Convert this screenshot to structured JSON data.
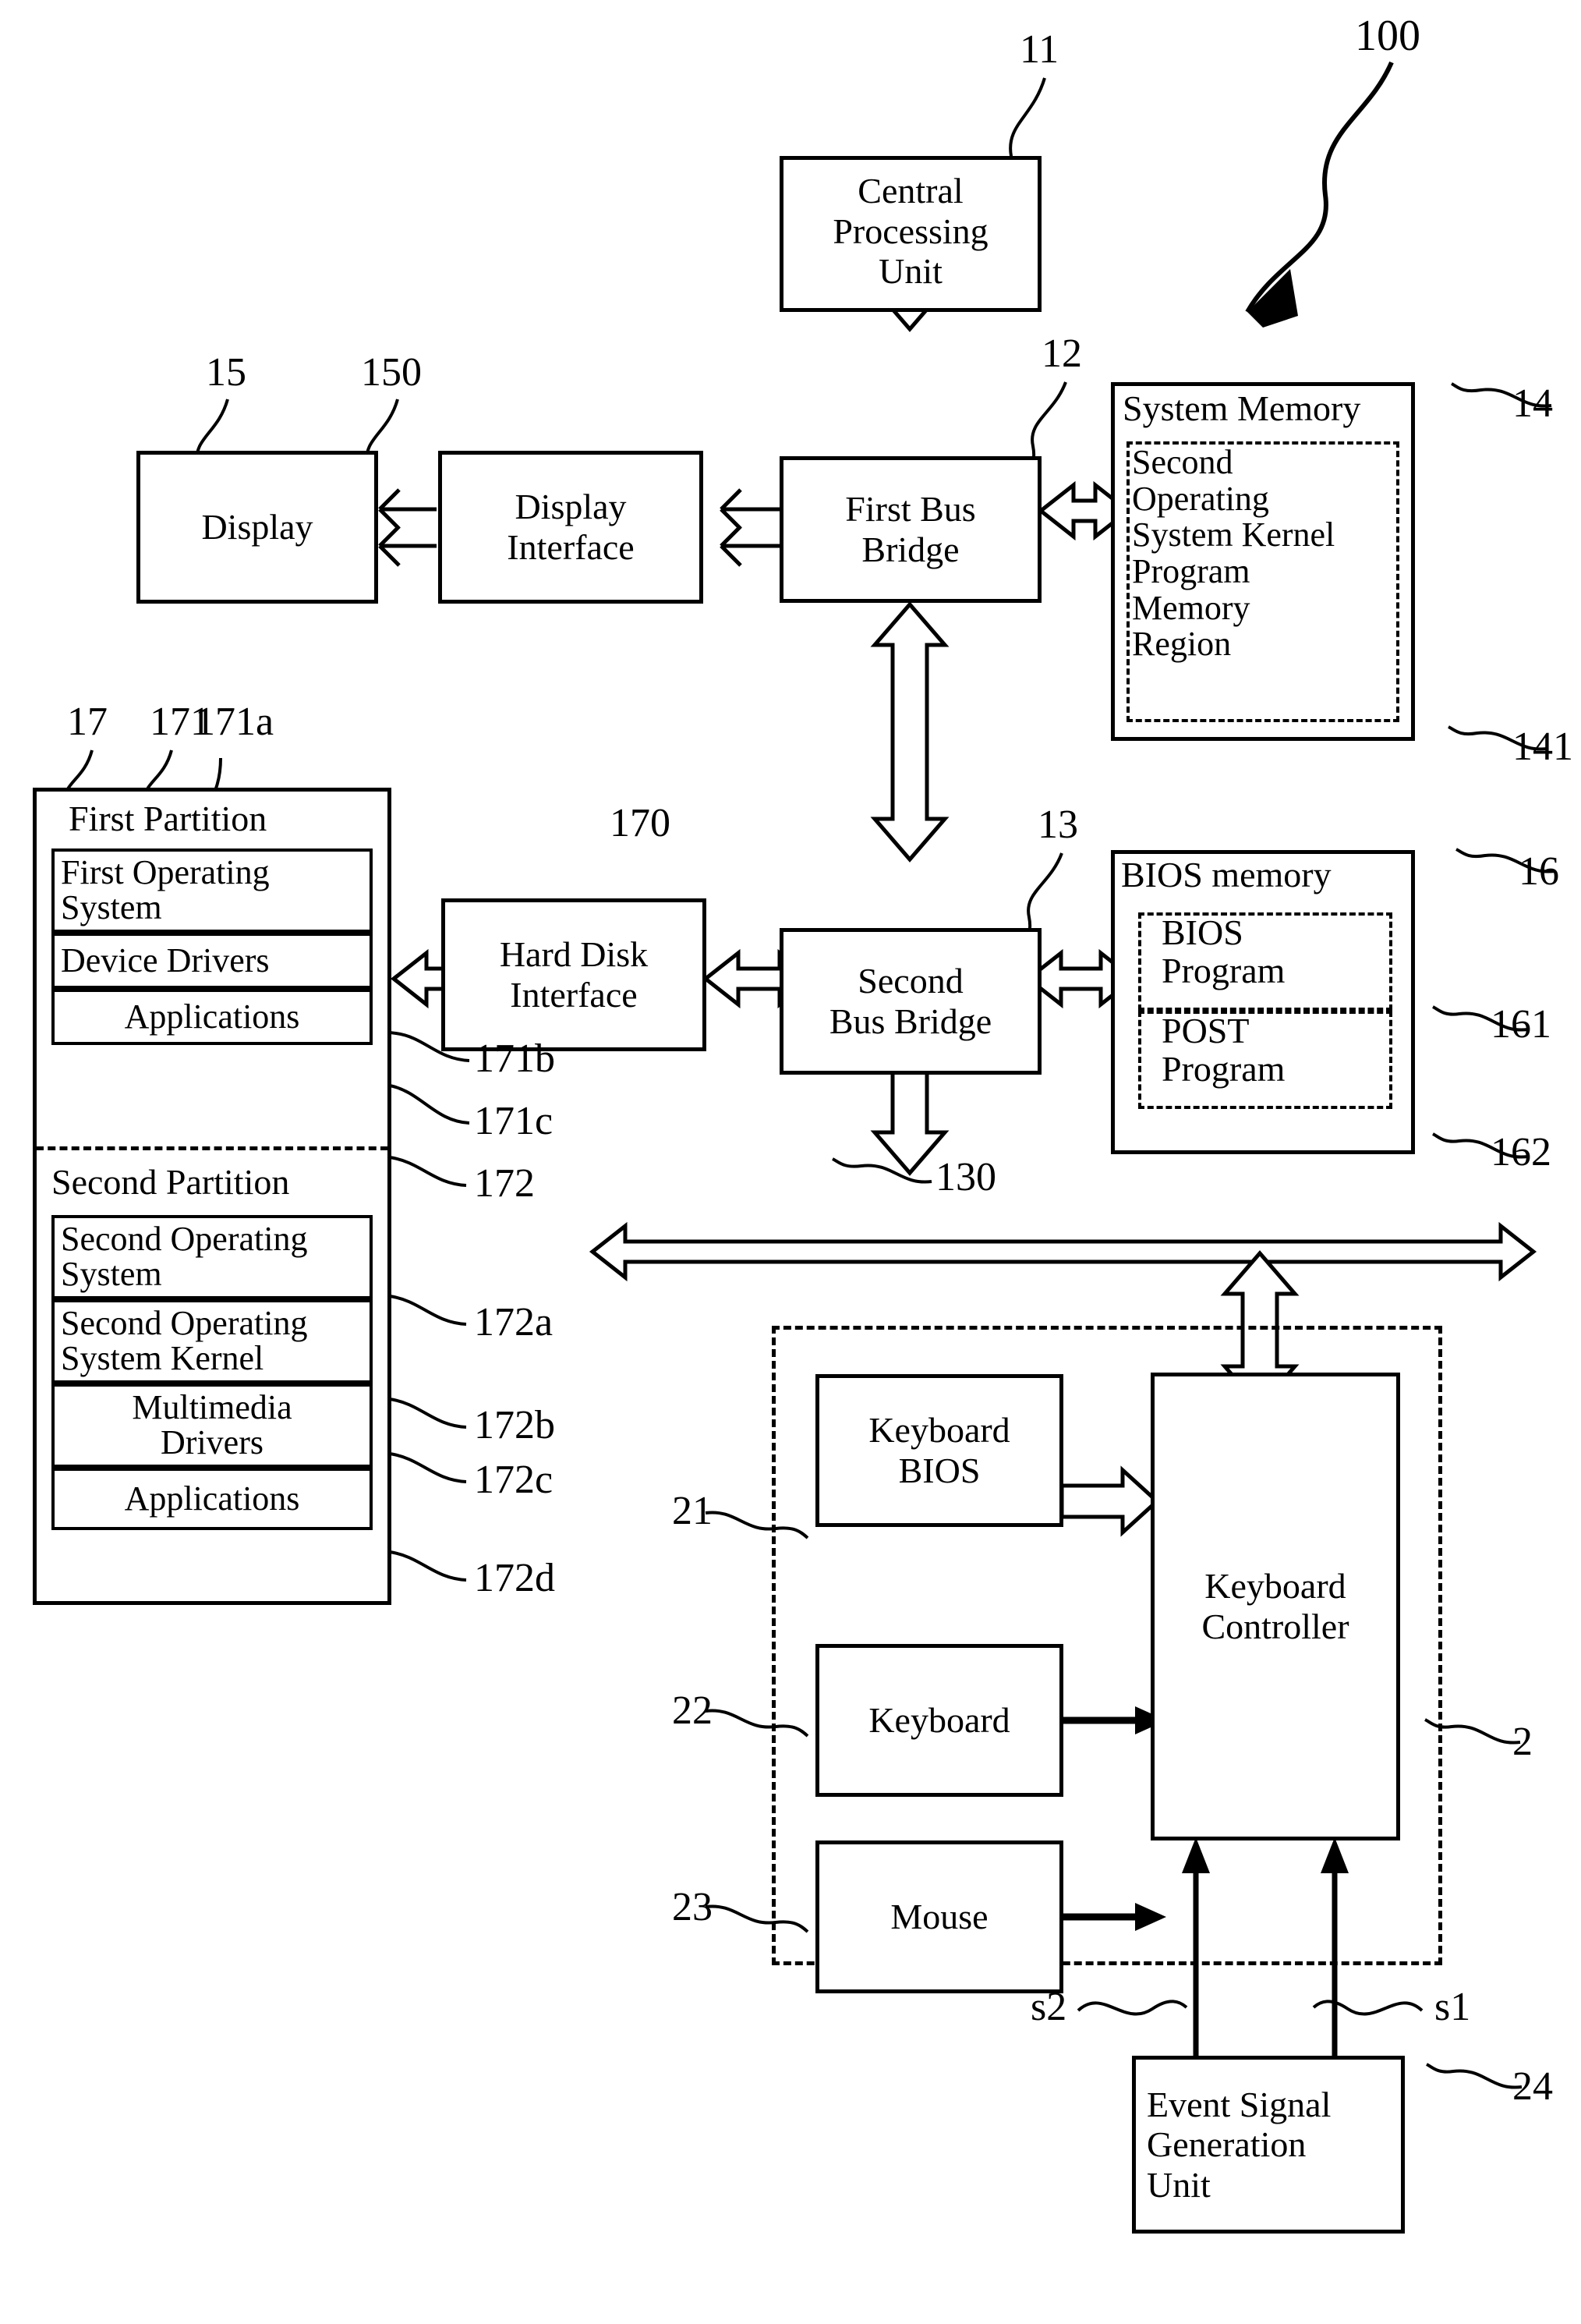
{
  "figure": {
    "system_ref": "100"
  },
  "blocks": {
    "cpu": {
      "label": "Central\nProcessing\nUnit",
      "ref": "11"
    },
    "first_bus_bridge": {
      "label": "First Bus\nBridge",
      "ref": "12"
    },
    "second_bus_bridge": {
      "label": "Second\nBus Bridge",
      "ref": "13"
    },
    "display": {
      "label": "Display",
      "ref": "15"
    },
    "display_interface": {
      "label": "Display\nInterface",
      "ref": "150"
    },
    "hard_disk_interface": {
      "label": "Hard Disk\nInterface",
      "ref": "170"
    },
    "system_memory": {
      "label": "System Memory",
      "ref": "14"
    },
    "second_os_kernel_region": {
      "label": "Second\nOperating\nSystem Kernel\nProgram\nMemory\nRegion",
      "ref": "141"
    },
    "bios_memory": {
      "label": "BIOS memory",
      "ref": "16"
    },
    "bios_program": {
      "label": "BIOS\nProgram",
      "ref": "161"
    },
    "post_program": {
      "label": "POST\nProgram",
      "ref": "162"
    },
    "hard_disk": {
      "ref": "17"
    },
    "first_partition": {
      "label": "First Partition",
      "ref": "171"
    },
    "first_os": {
      "label": "First Operating\nSystem",
      "ref": "171a"
    },
    "device_drivers": {
      "label": "Device Drivers",
      "ref": "171b"
    },
    "first_applications": {
      "label": "Applications",
      "ref": "171c"
    },
    "second_partition": {
      "label": "Second Partition",
      "ref": "172"
    },
    "second_os": {
      "label": "Second Operating\nSystem",
      "ref": "172a"
    },
    "second_os_kernel": {
      "label": "Second Operating\nSystem Kernel",
      "ref": "172b"
    },
    "multimedia_drivers": {
      "label": "Multimedia\nDrivers",
      "ref": "172c"
    },
    "second_applications": {
      "label": "Applications",
      "ref": "172d"
    },
    "keyboard_bios": {
      "label": "Keyboard\nBIOS",
      "ref": "21"
    },
    "keyboard": {
      "label": "Keyboard",
      "ref": "22"
    },
    "mouse": {
      "label": "Mouse",
      "ref": "23"
    },
    "keyboard_controller": {
      "label": "Keyboard\nController",
      "ref": "2"
    },
    "event_signal_generation_unit": {
      "label": "Event Signal\nGeneration\nUnit",
      "ref": "24"
    }
  },
  "buses": {
    "system_bus": {
      "ref": "130"
    }
  },
  "signals": {
    "s1": {
      "label": "s1"
    },
    "s2": {
      "label": "s2"
    }
  },
  "colors": {
    "line": "#000000",
    "background": "#ffffff"
  }
}
